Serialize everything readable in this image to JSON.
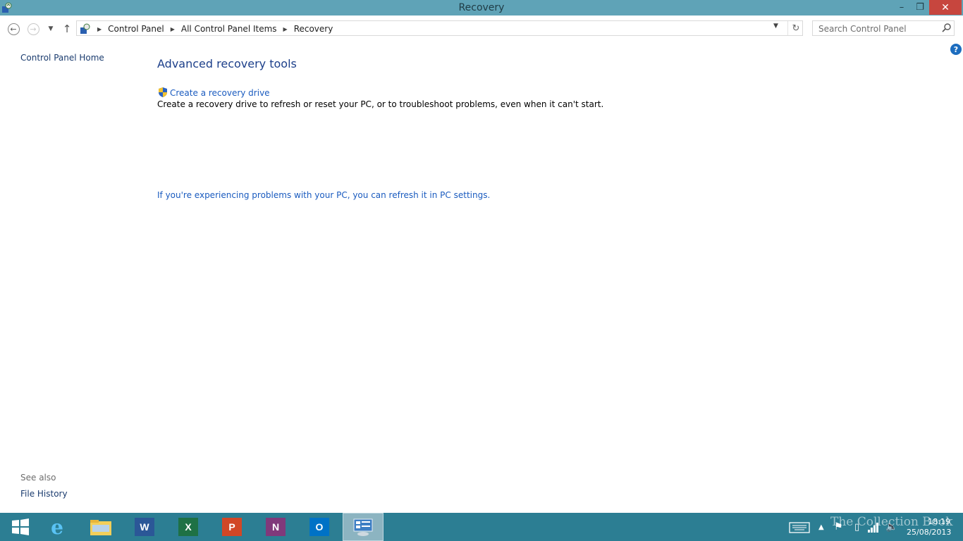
{
  "window": {
    "title": "Recovery",
    "controls": {
      "minimize": "–",
      "restore": "❐",
      "close": "✕"
    }
  },
  "nav": {
    "back_icon": "back-arrow-icon",
    "forward_icon": "forward-arrow-icon",
    "recent_icon": "chevron-down-icon",
    "up_icon": "up-arrow-icon",
    "breadcrumbs": [
      "Control Panel",
      "All Control Panel Items",
      "Recovery"
    ],
    "search_placeholder": "Search Control Panel"
  },
  "left_pane": {
    "home_link": "Control Panel Home",
    "see_also_label": "See also",
    "see_also_links": [
      "File History"
    ]
  },
  "main": {
    "heading": "Advanced recovery tools",
    "task": {
      "link": "Create a recovery drive",
      "description": "Create a recovery drive to refresh or reset your PC, or to troubleshoot problems, even when it can't start."
    },
    "refresh_link": "If you're experiencing problems with your PC, you can refresh it in PC settings.",
    "help_label": "?"
  },
  "taskbar": {
    "apps": [
      {
        "name": "start-button",
        "label": ""
      },
      {
        "name": "internet-explorer",
        "label": "e"
      },
      {
        "name": "file-explorer",
        "label": ""
      },
      {
        "name": "word",
        "label": "W"
      },
      {
        "name": "excel",
        "label": "X"
      },
      {
        "name": "powerpoint",
        "label": "P"
      },
      {
        "name": "onenote",
        "label": "N"
      },
      {
        "name": "outlook",
        "label": "O"
      },
      {
        "name": "control-panel",
        "label": ""
      }
    ],
    "clock_time": "18:19",
    "clock_date": "25/08/2013",
    "watermark": "The Collection Book"
  },
  "colors": {
    "titlebar": "#5fa3b7",
    "taskbar": "#2c7e93",
    "link": "#1a5bbf",
    "heading": "#1c3f8a",
    "close_button": "#c7463e"
  }
}
